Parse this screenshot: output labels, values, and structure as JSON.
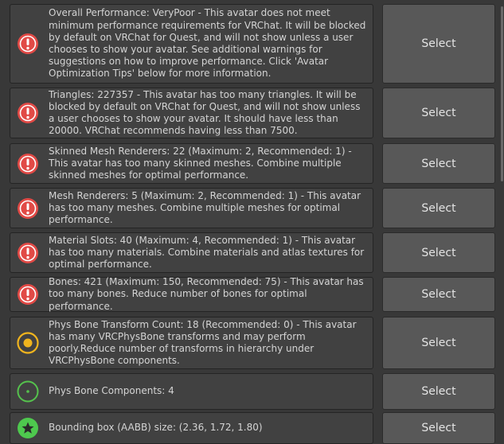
{
  "button_label": "Select",
  "colors": {
    "error": "#e14a46",
    "warning": "#f0b41e",
    "info": "#55c24d",
    "star": "#4ec84e"
  },
  "rows": [
    {
      "severity": "error",
      "icon": "error-icon",
      "text": "Overall Performance: VeryPoor - This avatar does not meet minimum performance requirements for VRChat. It will be blocked by default on VRChat for Quest, and will not show unless a user chooses to show your avatar. See additional warnings for suggestions on how to improve performance. Click 'Avatar Optimization Tips' below for more information."
    },
    {
      "severity": "error",
      "icon": "error-icon",
      "text": "Triangles: 227357 - This avatar has too many triangles. It will be blocked by default on VRChat for Quest, and will not show unless a user chooses to show your avatar. It should have less than 20000. VRChat recommends having less than 7500."
    },
    {
      "severity": "error",
      "icon": "error-icon",
      "text": "Skinned Mesh Renderers: 22 (Maximum: 2, Recommended: 1) - This avatar has too many skinned meshes. Combine multiple skinned meshes for optimal performance."
    },
    {
      "severity": "error",
      "icon": "error-icon",
      "text": "Mesh Renderers: 5 (Maximum: 2, Recommended: 1) - This avatar has too many meshes. Combine multiple meshes for optimal performance."
    },
    {
      "severity": "error",
      "icon": "error-icon",
      "text": "Material Slots: 40 (Maximum: 4, Recommended: 1) - This avatar has too many materials. Combine materials and atlas textures for optimal performance."
    },
    {
      "severity": "error",
      "icon": "error-icon",
      "text": "Bones: 421 (Maximum: 150, Recommended: 75) - This avatar has too many bones. Reduce number of bones for optimal performance."
    },
    {
      "severity": "warning",
      "icon": "warning-icon",
      "text": "Phys Bone Transform Count: 18 (Recommended: 0) - This avatar has many VRCPhysBone transforms and may perform poorly.Reduce number of transforms in hierarchy under VRCPhysBone components."
    },
    {
      "severity": "ok",
      "icon": "ok-icon",
      "text": "Phys Bone Components: 4"
    },
    {
      "severity": "good",
      "icon": "star-icon",
      "text": "Bounding box (AABB) size: (2.36, 1.72, 1.80)"
    }
  ]
}
